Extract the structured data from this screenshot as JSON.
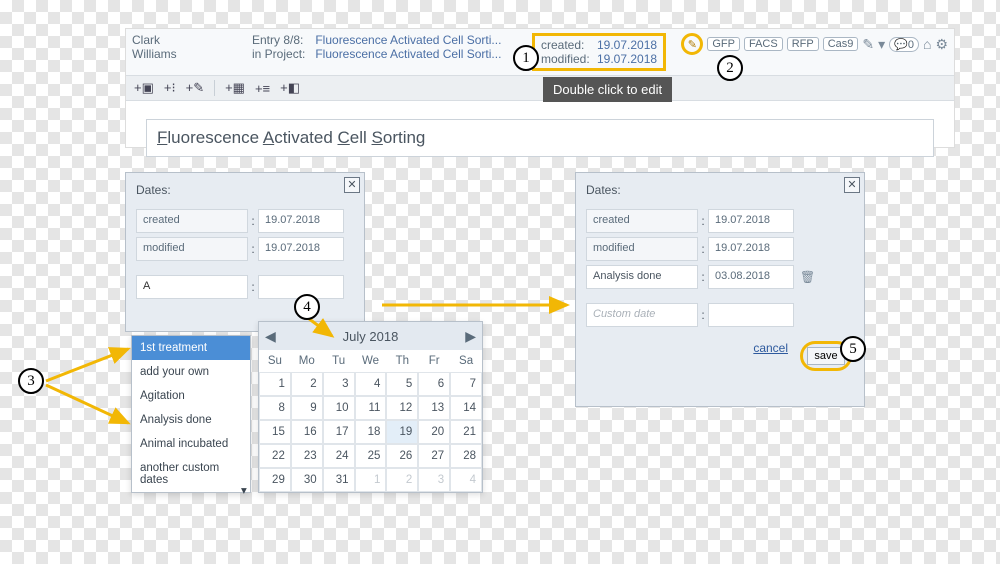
{
  "header": {
    "user_first": "Clark",
    "user_last": "Williams",
    "entry_meta_label": "Entry 8/8:",
    "project_meta_label": "in Project:",
    "entry_link": "Fluorescence Activated Cell Sorti...",
    "project_link": "Fluorescence Activated Cell Sorti...",
    "created_label": "created:",
    "modified_label": "modified:",
    "created_value": "19.07.2018",
    "modified_value": "19.07.2018",
    "tags": [
      "GFP",
      "FACS",
      "RFP",
      "Cas9"
    ],
    "badge_count": "0"
  },
  "tooltip": "Double click to edit",
  "title_parts": {
    "F": "F",
    "luorescence": "luorescence ",
    "A": "A",
    "ctivated": "ctivated ",
    "C": "C",
    "ell": "ell ",
    "S": "S",
    "orting": "orting"
  },
  "panel_left": {
    "title": "Dates:",
    "rows": [
      {
        "label": "created",
        "value": "19.07.2018"
      },
      {
        "label": "modified",
        "value": "19.07.2018"
      }
    ],
    "input_value": "A"
  },
  "suggestions": [
    "1st treatment",
    "add your own",
    "Agitation",
    "Analysis done",
    "Animal incubated",
    "another custom dates"
  ],
  "calendar": {
    "month": "July 2018",
    "dow": [
      "Su",
      "Mo",
      "Tu",
      "We",
      "Th",
      "Fr",
      "Sa"
    ],
    "weeks": [
      [
        1,
        2,
        3,
        4,
        5,
        6,
        7
      ],
      [
        8,
        9,
        10,
        11,
        12,
        13,
        14
      ],
      [
        15,
        16,
        17,
        18,
        19,
        20,
        21
      ],
      [
        22,
        23,
        24,
        25,
        26,
        27,
        28
      ],
      [
        29,
        30,
        31,
        1,
        2,
        3,
        4
      ]
    ],
    "today": 19,
    "muted_after": 31
  },
  "panel_right": {
    "title": "Dates:",
    "rows": [
      {
        "label": "created",
        "value": "19.07.2018"
      },
      {
        "label": "modified",
        "value": "19.07.2018"
      },
      {
        "label": "Analysis done",
        "value": "03.08.2018",
        "deletable": true
      }
    ],
    "custom_placeholder": "Custom date",
    "cancel": "cancel",
    "save": "save"
  },
  "annotations": {
    "1": "1",
    "2": "2",
    "3": "3",
    "4": "4",
    "5": "5"
  }
}
